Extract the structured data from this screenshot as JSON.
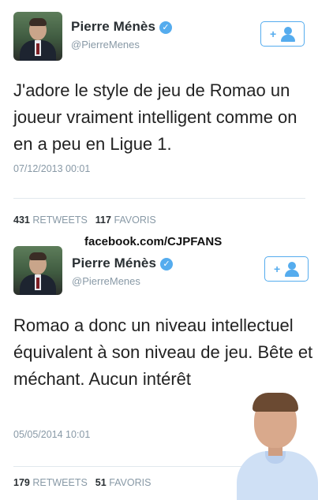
{
  "colors": {
    "accent": "#55acee",
    "meta": "#8899a6",
    "text": "#222222"
  },
  "tweets": [
    {
      "name": "Pierre Ménès",
      "handle": "@PierreMenes",
      "text": "J'adore le style de jeu de Romao un joueur vraiment intelligent comme on en a peu en Ligue 1.",
      "date": "07/12/2013 00:01",
      "retweets_count": "431",
      "retweets_label": "RETWEETS",
      "favorites_count": "117",
      "favorites_label": "FAVORIS",
      "follow_icon": "add-user-icon"
    },
    {
      "name": "Pierre Ménès",
      "handle": "@PierreMenes",
      "text": "Romao a donc un niveau intellectuel équivalent à son niveau de jeu. Bête et méchant. Aucun intérêt",
      "date": "05/05/2014 10:01",
      "retweets_count": "179",
      "retweets_label": "RETWEETS",
      "favorites_count": "51",
      "favorites_label": "FAVORIS",
      "follow_icon": "add-user-icon"
    }
  ],
  "watermark": "facebook.com/CJPFANS"
}
